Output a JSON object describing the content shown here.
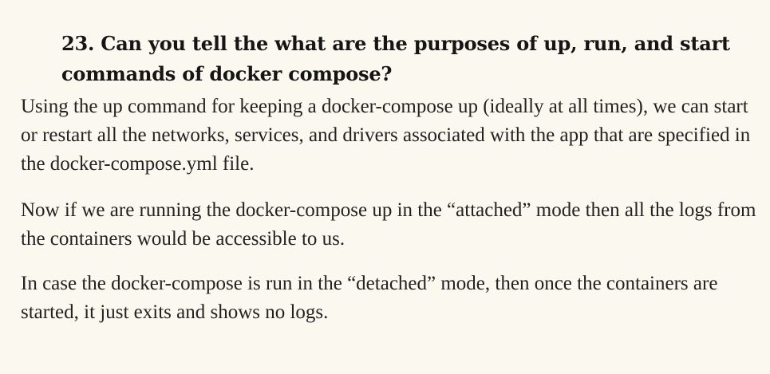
{
  "article": {
    "heading": "23. Can you tell the what are the purposes of up, run, and start commands of docker compose?",
    "paragraphs": [
      "Using the up command for keeping a docker-compose up (ideally at all times), we can start or restart all the networks, services, and drivers associated with the app that are specified in the docker-compose.yml file.",
      "Now if we are running the docker-compose up in the “attached” mode then all the logs from the containers would be accessible to us.",
      "In case the docker-compose is run in the “detached” mode, then once the containers are started, it just exits and shows no logs."
    ]
  }
}
